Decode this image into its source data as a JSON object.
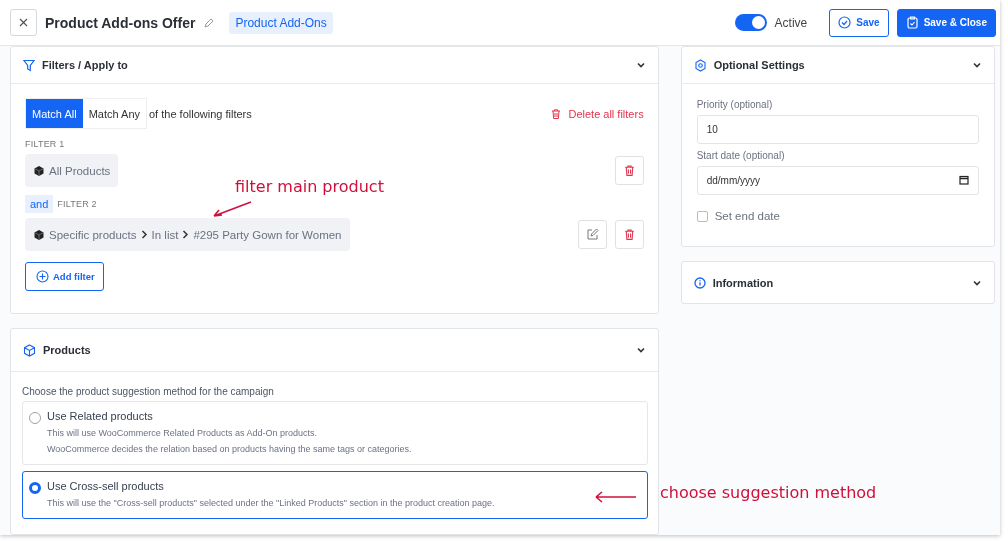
{
  "header": {
    "title": "Product Add-ons Offer",
    "badge": "Product Add-Ons",
    "status": {
      "label": "Active",
      "on": true
    },
    "buttons": [
      {
        "label": "Save",
        "kind": "outline"
      },
      {
        "label": "Save & Close",
        "kind": "primary"
      }
    ]
  },
  "filters_panel": {
    "title": "Filters / Apply to",
    "match": [
      {
        "label": "Match All",
        "selected": true
      },
      {
        "label": "Match Any",
        "selected": false
      }
    ],
    "match_suffix": "of the following filters",
    "delete_all": "Delete all filters",
    "filters": [
      {
        "label": "FILTER 1",
        "parts": [
          "All Products"
        ],
        "editable": false
      },
      {
        "conjunction": "and",
        "label": "FILTER 2",
        "parts": [
          "Specific products",
          "In list",
          "#295 Party Gown for Women"
        ],
        "editable": true
      }
    ],
    "add_filter": "Add filter"
  },
  "products_panel": {
    "title": "Products",
    "prompt": "Choose the product suggestion method for the campaign",
    "options": [
      {
        "title": "Use Related products",
        "lines": [
          "This will use WooCommerce Related Products as Add-On products.",
          "WooCommerce decides the relation based on products having the same tags or categories."
        ],
        "selected": false
      },
      {
        "title": "Use Cross-sell products",
        "lines": [
          "This will use the \"Cross-sell products\" selected under the \"Linked Products\" section in the product creation page."
        ],
        "selected": true
      }
    ]
  },
  "optional_settings": {
    "title": "Optional Settings",
    "fields": [
      {
        "kind": "text",
        "label": "Priority (optional)",
        "value": "10"
      },
      {
        "kind": "date",
        "label": "Start date (optional)",
        "placeholder": "dd/mm/yyyy"
      }
    ],
    "end_date": {
      "label": "Set end date",
      "checked": false
    }
  },
  "information": {
    "title": "Information"
  },
  "annotations": [
    {
      "kind": "filter",
      "text": "filter main product"
    },
    {
      "kind": "method",
      "text": "choose suggestion method"
    }
  ]
}
